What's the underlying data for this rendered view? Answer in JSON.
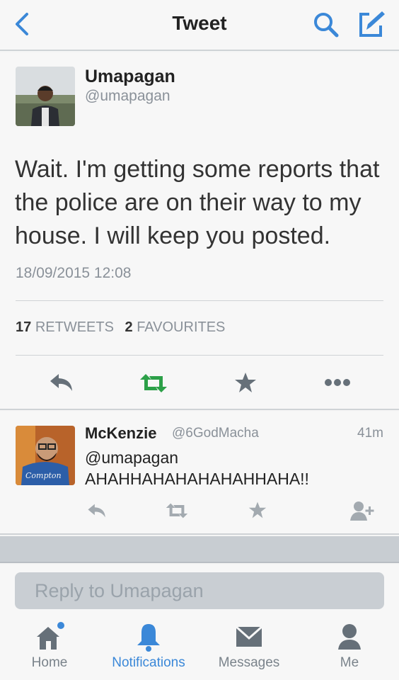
{
  "header": {
    "title": "Tweet"
  },
  "tweet": {
    "author_name": "Umapagan",
    "author_handle": "@umapagan",
    "text": "Wait. I'm getting some reports that the police are on their way to my house. I will keep you posted.",
    "timestamp": "18/09/2015 12:08",
    "retweets_count": "17",
    "retweets_label": "RETWEETS",
    "favourites_count": "2",
    "favourites_label": "FAVOURITES"
  },
  "reply": {
    "author_name": "McKenzie",
    "author_handle": "@6GodMacha",
    "time": "41m",
    "mention": "@umapagan",
    "text": "AHAHHAHAHAHAHAHHAHA!!",
    "avatar_shirt_text": "Compton"
  },
  "compose": {
    "placeholder": "Reply to Umapagan"
  },
  "tabs": [
    {
      "label": "Home",
      "icon": "home-icon",
      "active": false,
      "has_dot": true
    },
    {
      "label": "Notifications",
      "icon": "bell-icon",
      "active": true
    },
    {
      "label": "Messages",
      "icon": "envelope-icon",
      "active": false
    },
    {
      "label": "Me",
      "icon": "person-icon",
      "active": false
    }
  ],
  "colors": {
    "accent": "#3b88d8",
    "retweet": "#2ca048",
    "muted": "#8a9199"
  }
}
